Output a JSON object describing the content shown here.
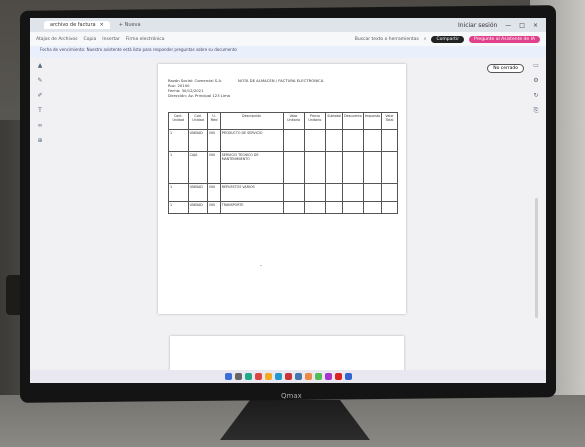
{
  "browser": {
    "tab_title": "archivo de factura",
    "new_tab_label": "+ Nueva",
    "window_controls": [
      "—",
      "□",
      "×"
    ],
    "bookmarks": [
      "Atajos de Archivos",
      "Copia",
      "Insertar",
      "Firma electrónica"
    ],
    "search_label": "Buscar texto o herramientas",
    "share_label": "Compartir",
    "ai_label": "Pregunte al Asistente de IA",
    "user_label": "Iniciar sesión",
    "info_text": "Fecha de vencimiento: Nuestro asistente está listo para responder preguntas sobre su documento",
    "close_label": "No cerrado"
  },
  "document": {
    "header_lines": [
      "Razón Social: Comercial S.A.",
      "Ruc: 20100",
      "Fecha: 30/12/2021",
      "Dirección: Av. Principal 123 Lima"
    ],
    "title": "NOTA DE ALMACEN / FACTURA ELECTRONICA",
    "columns": [
      "Cant. Unidad",
      "Cod. Unidad",
      "U. Med",
      "Descripción",
      "Valor Unitario",
      "Precio Unitario",
      "Subtotal",
      "Descuento",
      "Impuesto",
      "Valor Total"
    ],
    "rows": [
      {
        "c1": "1",
        "c2": "UNIDAD",
        "c3": "NIU",
        "desc": "PRODUCTO DE SERVICIO",
        "vu": "",
        "pu": "",
        "st": "",
        "dc": "",
        "im": "",
        "vt": ""
      },
      {
        "c1": "1",
        "c2": "CAJA",
        "c3": "NIU",
        "desc": "SERVICIO TECNICO DE MANTENIMIENTO",
        "vu": "",
        "pu": "",
        "st": "",
        "dc": "",
        "im": "",
        "vt": ""
      },
      {
        "c1": "1",
        "c2": "UNIDAD",
        "c3": "NIU",
        "desc": "REPUESTOS VARIOS",
        "vu": "",
        "pu": "",
        "st": "",
        "dc": "",
        "im": "",
        "vt": ""
      },
      {
        "c1": "1",
        "c2": "UNIDAD",
        "c3": "NIU",
        "desc": "TRANSPORTE",
        "vu": "",
        "pu": "",
        "st": "",
        "dc": "",
        "im": "",
        "vt": ""
      }
    ]
  },
  "monitor": {
    "brand": "Qmax"
  }
}
